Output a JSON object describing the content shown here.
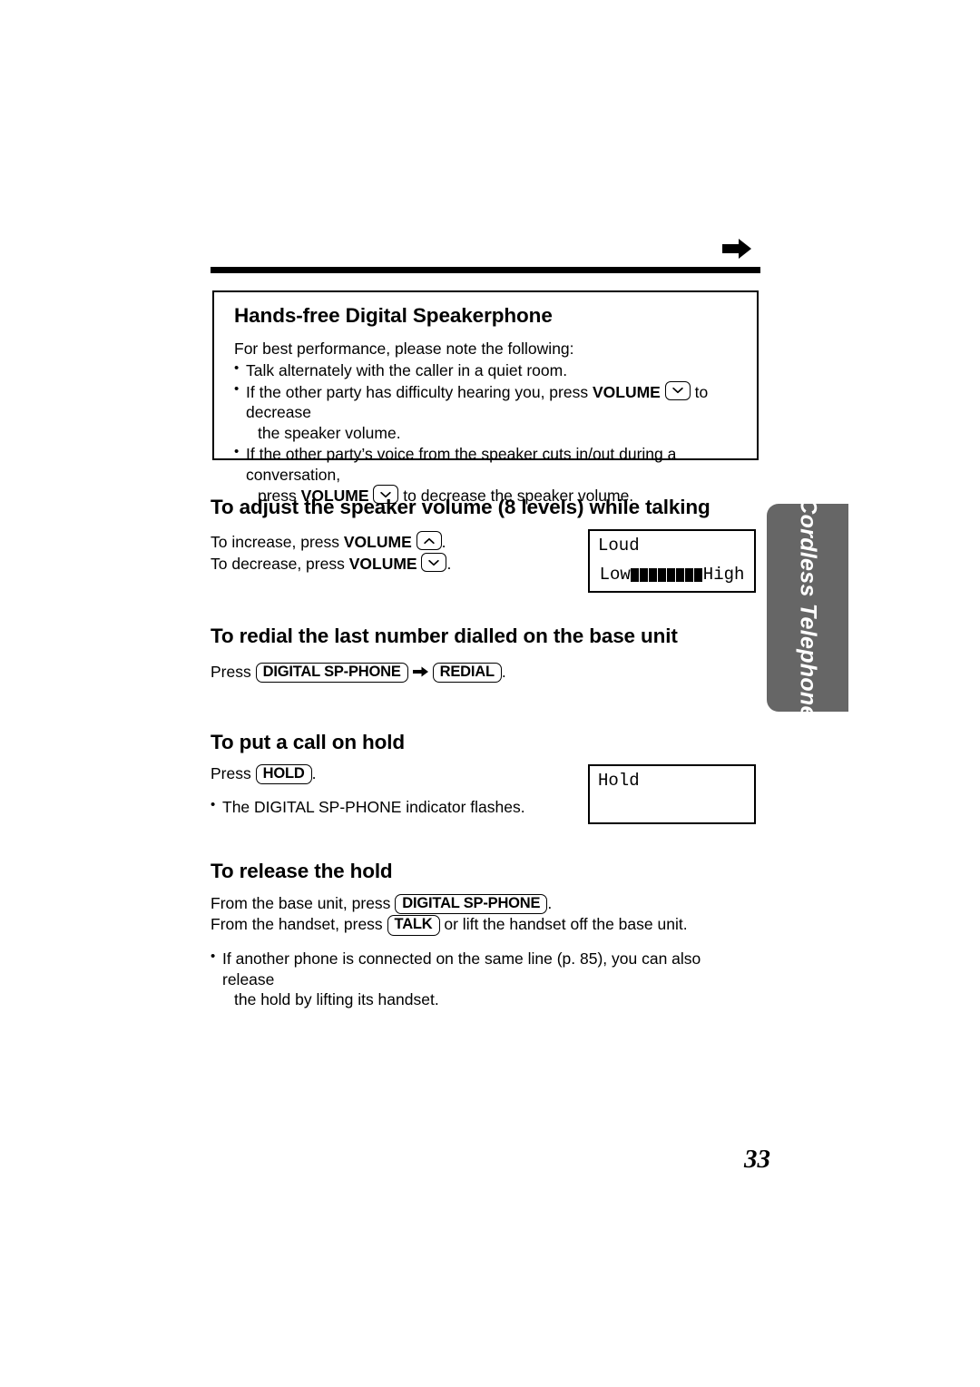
{
  "page": {
    "number": "33",
    "side_tab_label": "Cordless Telephone",
    "side_tab_color": "#666666",
    "top_arrow_icon": "right-arrow-icon"
  },
  "callout": {
    "title": "Hands-free Digital Speakerphone",
    "intro": "For best performance, please note the following:",
    "bullets": [
      {
        "text_1": "Talk alternately with the caller in a quiet room.",
        "bold_1": "",
        "text_2": "",
        "key": "",
        "text_3": "",
        "cont": ""
      },
      {
        "text_1": "If the other party has difficulty hearing you, press ",
        "bold_1": "VOLUME",
        "key": "chevron-down-icon",
        "text_3": " to decrease",
        "cont": "the speaker volume."
      },
      {
        "text_1": "If the other party’s voice from the speaker cuts in/out during a conversation,",
        "cont_pre": "press ",
        "bold_1": "VOLUME",
        "key": "chevron-down-icon",
        "text_3": " to decrease the speaker volume."
      }
    ]
  },
  "sections": {
    "volume": {
      "heading": "To adjust the speaker volume (8 levels) while talking",
      "line1_pre": "To increase, press ",
      "line1_bold": "VOLUME",
      "line1_key": "chevron-up-icon",
      "line1_post": ".",
      "line2_pre": "To decrease, press ",
      "line2_bold": "VOLUME",
      "line2_key": "chevron-down-icon",
      "line2_post": ".",
      "lcd": {
        "line1": "Loud",
        "low_label": "Low",
        "high_label": "High",
        "bar_count": 8
      }
    },
    "redial": {
      "heading": "To redial the last number dialled on the base unit",
      "press_label": "Press ",
      "key1": "DIGITAL SP-PHONE",
      "arrow_icon": "right-arrow-icon",
      "key2": "REDIAL",
      "period": "."
    },
    "hold": {
      "heading": "To put a call on hold",
      "press_label": "Press ",
      "key1": "HOLD",
      "period": ".",
      "note": "The DIGITAL SP-PHONE indicator flashes.",
      "lcd": {
        "line1": "Hold"
      }
    },
    "release": {
      "heading": "To release the hold",
      "line1_pre": "From the base unit, press ",
      "line1_key": "DIGITAL SP-PHONE",
      "line1_post": ".",
      "line2_pre": "From the handset, press ",
      "line2_key": "TALK",
      "line2_post": " or lift the handset off the base unit.",
      "note_line1": "If another phone is connected on the same line (p. 85), you can also release",
      "note_line2": "the hold by lifting its handset."
    }
  }
}
